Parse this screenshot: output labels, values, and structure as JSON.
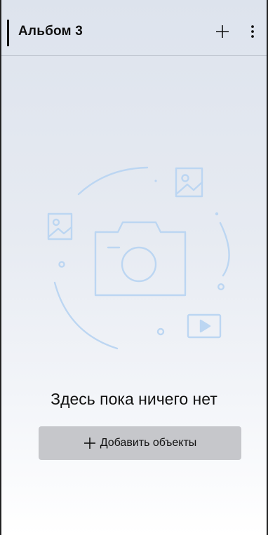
{
  "header": {
    "title": "Альбом 3",
    "icons": [
      "plus-icon",
      "more-vertical-icon"
    ]
  },
  "empty_state": {
    "message": "Здесь пока ничего нет",
    "illustration_icons": [
      "camera-icon",
      "image-icon",
      "image-icon",
      "play-icon"
    ],
    "accent_color": "#bcd6f2"
  },
  "actions": {
    "add_objects_label": "Добавить объекты",
    "add_objects_icon": "plus-icon"
  }
}
